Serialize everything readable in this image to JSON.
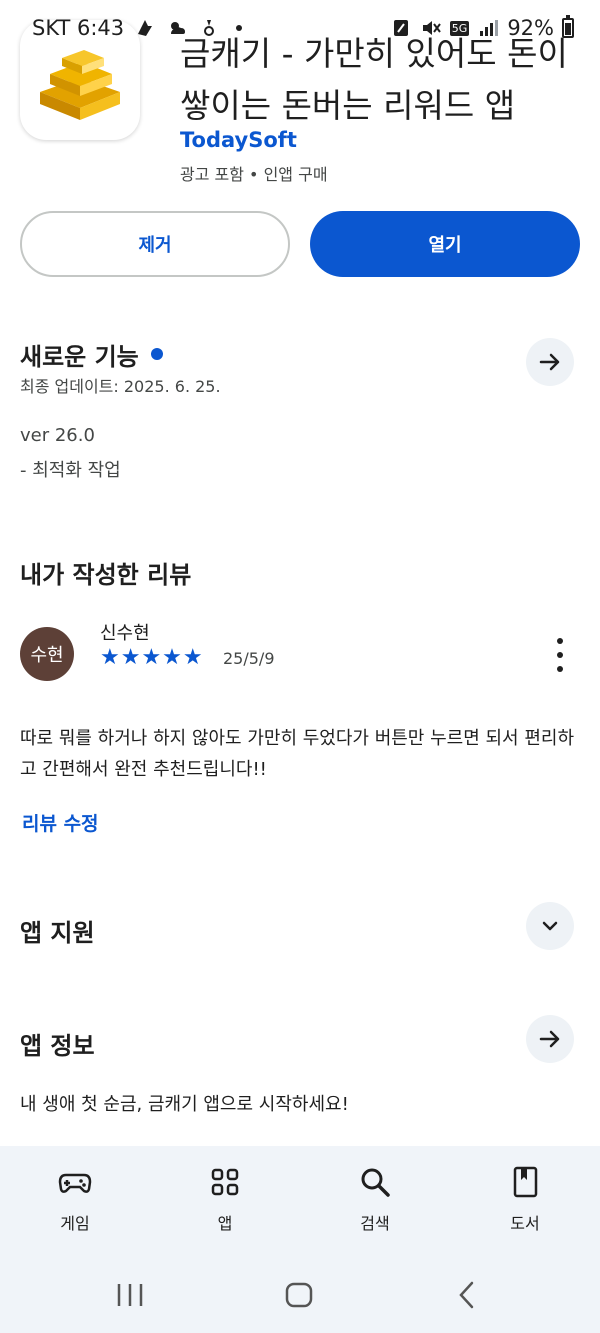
{
  "status_bar": {
    "carrier_time": "SKT 6:43",
    "network": "5G",
    "battery": "92%"
  },
  "app": {
    "title": "금캐기 - 가만히 있어도 돈이 쌓이는 돈버는 리워드 앱",
    "developer": "TodaySoft",
    "meta": "광고 포함 • 인앱 구매",
    "icon": "gold-bars-icon"
  },
  "actions": {
    "uninstall_label": "제거",
    "open_label": "열기"
  },
  "whats_new": {
    "title": "새로운 기능",
    "last_updated": "최종 업데이트: 2025. 6. 25.",
    "version": "ver 26.0",
    "notes": "- 최적화 작업"
  },
  "my_review": {
    "title": "내가 작성한 리뷰",
    "avatar_text": "수현",
    "reviewer": "신수현",
    "rating": 5,
    "stars": "★★★★★",
    "date": "25/5/9",
    "text": "따로 뭐를 하거나 하지 않아도 가만히 두었다가 버튼만 누르면 되서 편리하고 간편해서 완전 추천드립니다!!",
    "edit_label": "리뷰 수정"
  },
  "app_support": {
    "title": "앱 지원"
  },
  "app_info": {
    "title": "앱 정보",
    "description": "내 생애 첫 순금, 금캐기 앱으로 시작하세요!"
  },
  "bottom_nav": {
    "items": [
      {
        "label": "게임",
        "icon": "gamepad-icon"
      },
      {
        "label": "앱",
        "icon": "apps-grid-icon"
      },
      {
        "label": "검색",
        "icon": "search-icon"
      },
      {
        "label": "도서",
        "icon": "book-icon"
      }
    ]
  },
  "colors": {
    "accent": "#0b57d0",
    "avatar": "#5d4037",
    "nav_bg": "#f0f4f9"
  }
}
